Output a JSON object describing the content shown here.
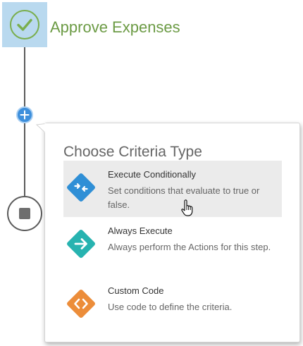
{
  "workflow": {
    "step_title": "Approve Expenses",
    "step_icon": "check-circle-icon",
    "add_icon": "plus-icon",
    "end_icon": "stop-icon"
  },
  "criteria_popup": {
    "title": "Choose Criteria Type",
    "options": [
      {
        "name": "Execute Conditionally",
        "description": "Set conditions that evaluate to true or false.",
        "icon": "execute-conditionally-icon",
        "color": "#2f8fd6",
        "hovered": true
      },
      {
        "name": "Always Execute",
        "description": "Always perform the Actions for this step.",
        "icon": "arrow-right-icon",
        "color": "#27b3b0"
      },
      {
        "name": "Custom Code",
        "description": "Use code to define the criteria.",
        "icon": "code-brackets-icon",
        "color": "#ec8d3a"
      }
    ]
  },
  "colors": {
    "step_accent": "#6c9b45",
    "step_box": "#b9d9ef",
    "add_button": "#3d8fdc",
    "hover_background": "#ebebeb"
  }
}
